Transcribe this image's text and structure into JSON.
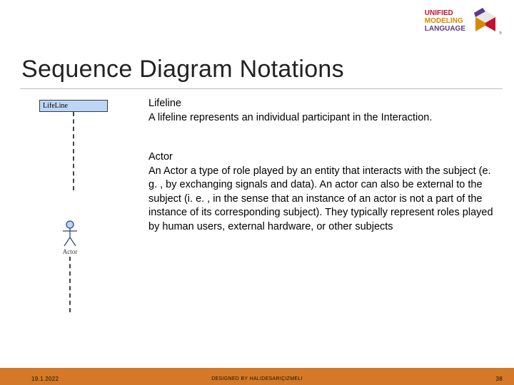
{
  "logo": {
    "line1": "UNIFIED",
    "line2": "MODELING",
    "line3": "LANGUAGE"
  },
  "title": "Sequence Diagram Notations",
  "lifeline_box_label": "LifeLine",
  "lifeline": {
    "heading": "Lifeline",
    "body": "A lifeline represents an individual participant in the Interaction."
  },
  "actor_label": "Actor",
  "actor": {
    "heading": "Actor",
    "body": "An Actor a type of role played by an entity that interacts with the subject (e. g. , by exchanging signals and data). An actor can also be external to the subject (i. e. , in the sense that an instance of an actor is not a part of the instance of its corresponding subject). They typically represent roles played by human users, external hardware, or other subjects"
  },
  "footer": {
    "date": "19.1.2022",
    "designed_by": "DESIGNED BY HALIDESARIÇIZMELI",
    "page": "38"
  }
}
